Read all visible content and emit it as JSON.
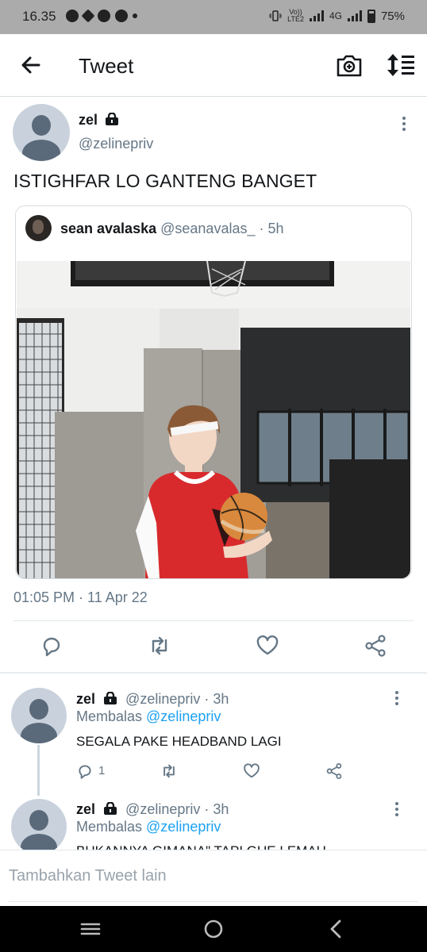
{
  "status_bar": {
    "time": "16.35",
    "network": "4G",
    "volte": "Vo))\nLTE2",
    "battery": "75%"
  },
  "app_bar": {
    "title": "Tweet",
    "icons": [
      "back-arrow-icon",
      "camera-icon",
      "sort-icon"
    ]
  },
  "main_tweet": {
    "name": "zel",
    "handle": "@zelinepriv",
    "text": "ISTIGHFAR LO GANTENG BANGET",
    "timestamp": "01:05 PM · 11 Apr 22",
    "quote": {
      "name": "sean avalaska",
      "handle": "@seanavalas_ · 5h"
    },
    "actions": [
      "reply-icon",
      "retweet-icon",
      "like-icon",
      "share-icon"
    ]
  },
  "replies": [
    {
      "name": "zel",
      "handle": "@zelinepriv · 3h",
      "replying_prefix": "Membalas ",
      "replying_to": "@zelinepriv",
      "text": "SEGALA PAKE HEADBAND LAGI",
      "reply_count": "1"
    },
    {
      "name": "zel",
      "handle": "@zelinepriv · 3h",
      "replying_prefix": "Membalas ",
      "replying_to": "@zelinepriv",
      "text": "BUKANNYA GIMANA\" TAPI GUE LEMAH"
    }
  ],
  "compose": {
    "placeholder": "Tambahkan Tweet lain"
  },
  "colors": {
    "accent": "#1da1f2",
    "text": "#14171a",
    "secondary": "#657786",
    "status_bar": "#ababab"
  }
}
